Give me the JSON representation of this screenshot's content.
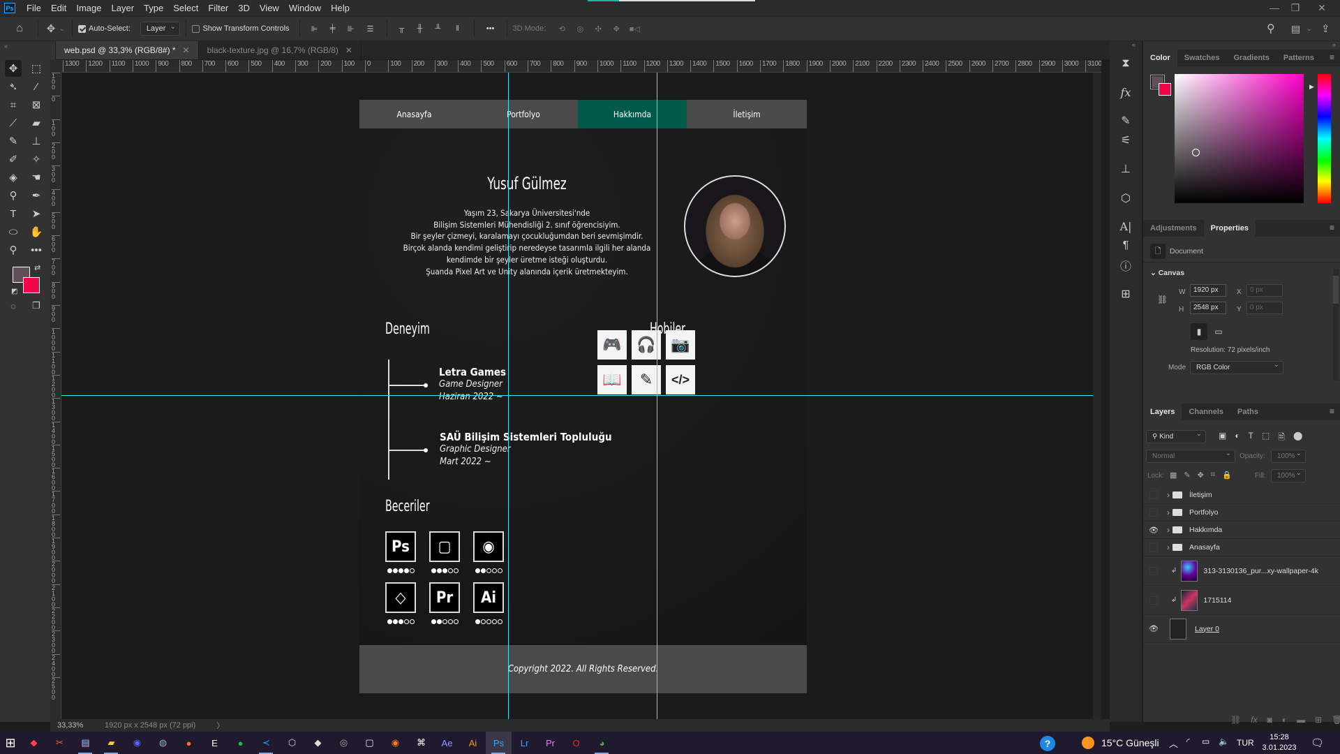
{
  "app": {
    "name": "Photoshop",
    "logo": "Ps"
  },
  "menu": [
    "File",
    "Edit",
    "Image",
    "Layer",
    "Type",
    "Select",
    "Filter",
    "3D",
    "View",
    "Window",
    "Help"
  ],
  "window_controls": {
    "minimize": "—",
    "restore": "❐",
    "close": "✕"
  },
  "options_bar": {
    "auto_select_label": "Auto-Select:",
    "auto_select_checked": true,
    "auto_select_target": "Layer",
    "show_transform_label": "Show Transform Controls",
    "show_transform_checked": false,
    "three_d_mode_label": "3D Mode:",
    "more_label": "•••"
  },
  "document_tabs": [
    {
      "label": "web.psd @ 33,3% (RGB/8#) *",
      "active": true
    },
    {
      "label": "black-texture.jpg @ 16,7% (RGB/8)",
      "active": false
    }
  ],
  "ruler": {
    "h_ticks": [
      "1300",
      "1200",
      "1100",
      "1000",
      "900",
      "800",
      "700",
      "600",
      "500",
      "400",
      "300",
      "200",
      "100",
      "0",
      "100",
      "200",
      "300",
      "400",
      "500",
      "600",
      "700",
      "800",
      "900",
      "1000",
      "1100",
      "1200",
      "1300",
      "1400",
      "1500",
      "1600",
      "1700",
      "1800",
      "1900",
      "2000",
      "2100",
      "2200",
      "2300",
      "2400",
      "2500",
      "2600",
      "2700",
      "2800",
      "2900",
      "3000",
      "3100"
    ],
    "v_ticks": [
      "1 0 0",
      "0",
      "1 0 0",
      "2 0 0",
      "3 0 0",
      "4 0 0",
      "5 0 0",
      "6 0 0",
      "7 0 0",
      "8 0 0",
      "9 0 0",
      "1 0 0 0",
      "1 1 0 0",
      "1 2 0 0",
      "1 3 0 0",
      "1 4 0 0",
      "1 5 0 0",
      "1 6 0 0",
      "1 7 0 0",
      "1 8 0 0",
      "1 9 0 0",
      "2 0 0 0",
      "2 1 0 0",
      "2 2 0 0",
      "2 3 0 0",
      "2 4 0 0",
      "2 5 0 0"
    ]
  },
  "canvas": {
    "nav": [
      {
        "label": "Anasayfa",
        "active": false
      },
      {
        "label": "Portfolyo",
        "active": false
      },
      {
        "label": "Hakkımda",
        "active": true
      },
      {
        "label": "İletişim",
        "active": false
      }
    ],
    "nav_active_color": "#005a4a",
    "name": "Yusuf Gülmez",
    "bio": [
      "Yaşım 23, Sakarya Üniversitesi'nde",
      "Bilişim Sistemleri Mühendisliği 2. sınıf öğrencisiyim.",
      "Bir şeyler çizmeyi, karalamayı çocukluğumdan beri sevmişimdir.",
      "Birçok alanda kendimi geliştirip neredeyse tasarımla ilgili her alanda",
      "kendimde bir şeyler üretme isteği oluşturdu.",
      "Şuanda Pixel Art ve Unity alanında içerik üretmekteyim."
    ],
    "experience_title": "Deneyim",
    "experience": [
      {
        "company": "Letra Games",
        "role": "Game Designer",
        "date": "Haziran 2022 ~"
      },
      {
        "company": "SAÜ Bilişim Sistemleri Topluluğu",
        "role": "Graphic Designer",
        "date": "Mart 2022 ~"
      }
    ],
    "hobbies_title": "Hobiler",
    "hobbies": [
      {
        "name": "gamepad",
        "glyph": "🎮"
      },
      {
        "name": "headphones",
        "glyph": "🎧"
      },
      {
        "name": "camera",
        "glyph": "📷"
      },
      {
        "name": "book",
        "glyph": "📖"
      },
      {
        "name": "drawing-tablet",
        "glyph": "✎"
      },
      {
        "name": "code",
        "glyph": "</>"
      }
    ],
    "skills_title": "Beceriler",
    "skills": [
      {
        "name": "photoshop",
        "label": "Ps",
        "rating": 4,
        "max": 5
      },
      {
        "name": "aseprite",
        "label": "▢",
        "rating": 3,
        "max": 5
      },
      {
        "name": "blender",
        "label": "◉",
        "rating": 2,
        "max": 5
      },
      {
        "name": "unity",
        "label": "◇",
        "rating": 3,
        "max": 5
      },
      {
        "name": "premiere",
        "label": "Pr",
        "rating": 2,
        "max": 5
      },
      {
        "name": "illustrator",
        "label": "Ai",
        "rating": 1,
        "max": 5
      }
    ],
    "footer": "Copyright 2022. All Rights Reserved."
  },
  "status_bar": {
    "zoom": "33,33%",
    "doc_info": "1920 px x 2548 px (72 ppi)",
    "arrow": "〉"
  },
  "color_panel": {
    "tabs": [
      {
        "label": "Color",
        "active": true
      },
      {
        "label": "Swatches",
        "active": false
      },
      {
        "label": "Gradients",
        "active": false
      },
      {
        "label": "Patterns",
        "active": false
      }
    ],
    "foreground": "#605058",
    "background": "#f0054a",
    "hue_color": "#ff00cc"
  },
  "properties_panel": {
    "tabs": [
      {
        "label": "Adjustments",
        "active": false
      },
      {
        "label": "Properties",
        "active": true
      }
    ],
    "doc_label": "Document",
    "section": "Canvas",
    "w_label": "W",
    "w": "1920 px",
    "h_label": "H",
    "h": "2548 px",
    "x_label": "X",
    "x": "0 px",
    "y_label": "Y",
    "y": "0 px",
    "resolution": "Resolution: 72 pixels/inch",
    "mode_label": "Mode",
    "mode": "RGB Color"
  },
  "layers_panel": {
    "tabs": [
      {
        "label": "Layers",
        "active": true
      },
      {
        "label": "Channels",
        "active": false
      },
      {
        "label": "Paths",
        "active": false
      }
    ],
    "filter": "Kind",
    "blend_mode": "Normal",
    "opacity_label": "Opacity:",
    "opacity": "100%",
    "lock_label": "Lock:",
    "fill_label": "Fill:",
    "fill": "100%",
    "layers": [
      {
        "name": "İletişim",
        "type": "group",
        "visible": false
      },
      {
        "name": "Portfolyo",
        "type": "group",
        "visible": false
      },
      {
        "name": "Hakkımda",
        "type": "group",
        "visible": true
      },
      {
        "name": "Anasayfa",
        "type": "group",
        "visible": false
      },
      {
        "name": "313-3130136_pur...xy-wallpaper-4k",
        "type": "smart",
        "visible": false
      },
      {
        "name": "1715114",
        "type": "smart",
        "visible": false
      },
      {
        "name": "Layer 0",
        "type": "pixel",
        "visible": true
      }
    ]
  },
  "taskbar": {
    "apps": [
      "start",
      "app-red",
      "app-tool",
      "task-manager",
      "file-explorer",
      "discord",
      "steam",
      "origin",
      "epic-games",
      "spotify",
      "vscode",
      "unity-hub",
      "unity",
      "app-gray",
      "aseprite",
      "blender",
      "app-capcut",
      "after-effects",
      "illustrator",
      "photoshop",
      "lightroom",
      "premiere",
      "opera",
      "chrome"
    ],
    "weather": "15°C  Güneşli",
    "language": "TUR",
    "time": "15:28",
    "date": "3.01.2023"
  }
}
